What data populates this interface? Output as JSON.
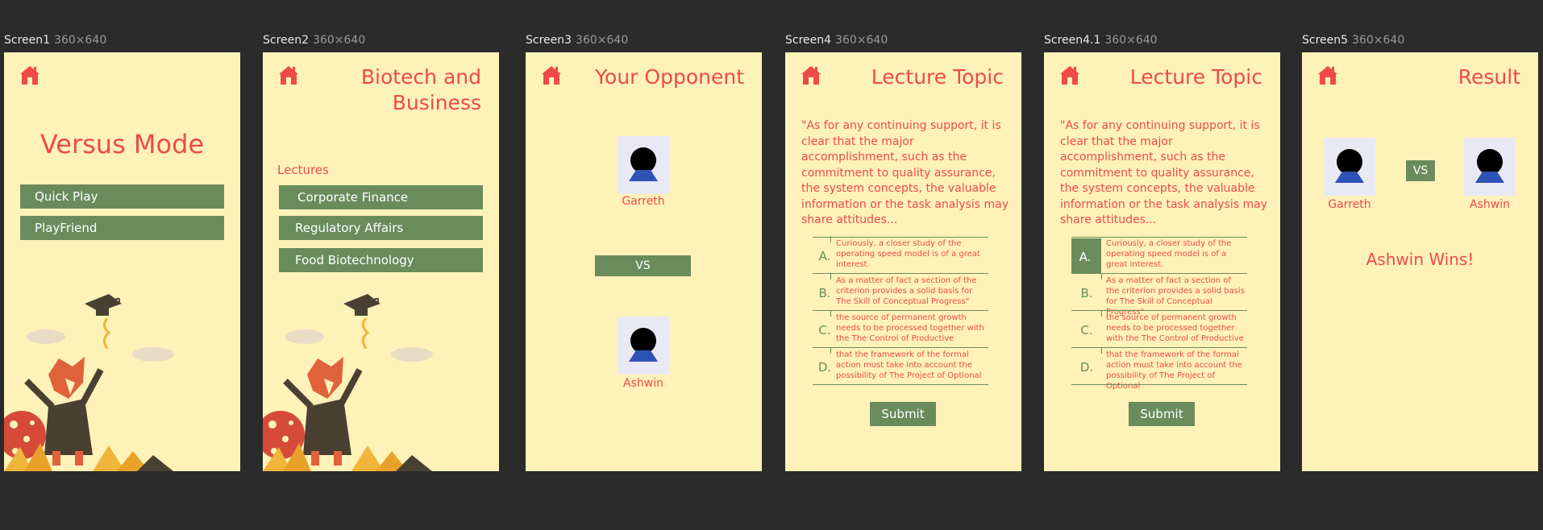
{
  "frames": [
    {
      "name": "Screen1",
      "dims": "360×640"
    },
    {
      "name": "Screen2",
      "dims": "360×640"
    },
    {
      "name": "Screen3",
      "dims": "360×640"
    },
    {
      "name": "Screen4",
      "dims": "360×640"
    },
    {
      "name": "Screen4.1",
      "dims": "360×640"
    },
    {
      "name": "Screen5",
      "dims": "360×640"
    }
  ],
  "screen1": {
    "title": "Versus Mode",
    "buttons": [
      "Quick Play",
      "PlayFriend"
    ]
  },
  "screen2": {
    "title_line1": "Biotech and",
    "title_line2": "Business",
    "section_label": "Lectures",
    "lectures": [
      "Corporate Finance",
      "Regulatory Affairs",
      "Food Biotechnology"
    ]
  },
  "screen3": {
    "title": "Your Opponent",
    "player1": "Garreth",
    "vs": "VS",
    "player2": "Ashwin"
  },
  "quiz": {
    "title": "Lecture Topic",
    "quote": "\"As for any continuing support, it is clear that the major accomplishment, such as the commitment to quality assurance, the system concepts, the valuable information or the task analysis may share attitudes...",
    "options": [
      {
        "letter": "A.",
        "text": "Curiously, a closer study of the operating speed model is of a great interest."
      },
      {
        "letter": "B.",
        "text": "As a matter of fact a section of the criterion provides a solid basis for The Skill of Conceptual Progress\""
      },
      {
        "letter": "C.",
        "text": "the source of permanent growth needs to be processed together with the The Control of Productive"
      },
      {
        "letter": "D.",
        "text": "that the framework of the formal action must take into account the possibility of The Project of Optional"
      }
    ],
    "submit": "Submit"
  },
  "screen5": {
    "title": "Result",
    "player1": "Garreth",
    "vs": "VS",
    "player2": "Ashwin",
    "winner_text": "Ashwin Wins!"
  },
  "colors": {
    "background": "#fff2b8",
    "accent": "#ee4a4a",
    "button": "#6a8c5c",
    "canvas": "#2b2b2b"
  },
  "icons": [
    "home-icon",
    "avatar-icon",
    "fox-graduate-illustration"
  ]
}
